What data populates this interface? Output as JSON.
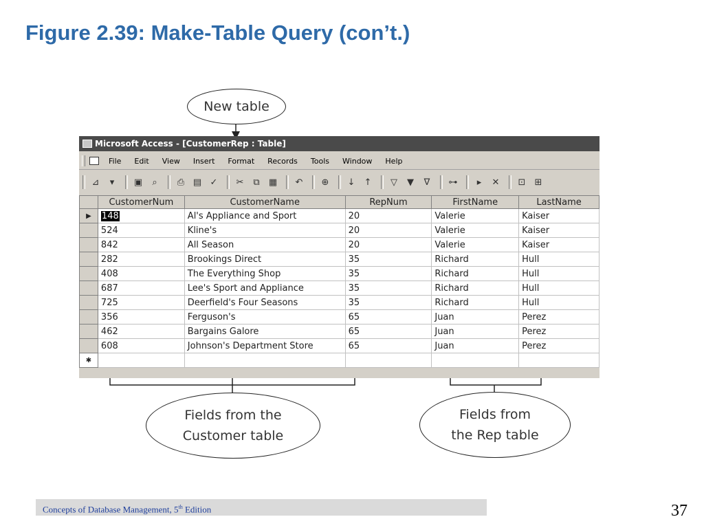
{
  "slide": {
    "title": "Figure 2.39: Make-Table Query (con’t.)",
    "footer_prefix": "Concepts of Database Management, 5",
    "footer_sup": "th",
    "footer_suffix": " Edition",
    "page_number": "37"
  },
  "callouts": {
    "new_table": "New table",
    "customer_fields": "Fields from the\nCustomer table",
    "rep_fields": "Fields from\nthe Rep table"
  },
  "window": {
    "title": "Microsoft Access - [CustomerRep : Table]",
    "menu": [
      "File",
      "Edit",
      "View",
      "Insert",
      "Format",
      "Records",
      "Tools",
      "Window",
      "Help"
    ]
  },
  "table": {
    "columns": [
      "CustomerNum",
      "CustomerName",
      "RepNum",
      "FirstName",
      "LastName"
    ],
    "rows": [
      [
        "148",
        "Al's Appliance and Sport",
        "20",
        "Valerie",
        "Kaiser"
      ],
      [
        "524",
        "Kline's",
        "20",
        "Valerie",
        "Kaiser"
      ],
      [
        "842",
        "All Season",
        "20",
        "Valerie",
        "Kaiser"
      ],
      [
        "282",
        "Brookings Direct",
        "35",
        "Richard",
        "Hull"
      ],
      [
        "408",
        "The Everything Shop",
        "35",
        "Richard",
        "Hull"
      ],
      [
        "687",
        "Lee's Sport and Appliance",
        "35",
        "Richard",
        "Hull"
      ],
      [
        "725",
        "Deerfield's Four Seasons",
        "35",
        "Richard",
        "Hull"
      ],
      [
        "356",
        "Ferguson's",
        "65",
        "Juan",
        "Perez"
      ],
      [
        "462",
        "Bargains Galore",
        "65",
        "Juan",
        "Perez"
      ],
      [
        "608",
        "Johnson's Department Store",
        "65",
        "Juan",
        "Perez"
      ]
    ]
  },
  "icons": {
    "record_selector": "▶",
    "new_record": "✱"
  },
  "colors": {
    "title": "#2e6aa8",
    "footer_text": "#1f3f9c",
    "titlebar": "#4a4a4a"
  }
}
